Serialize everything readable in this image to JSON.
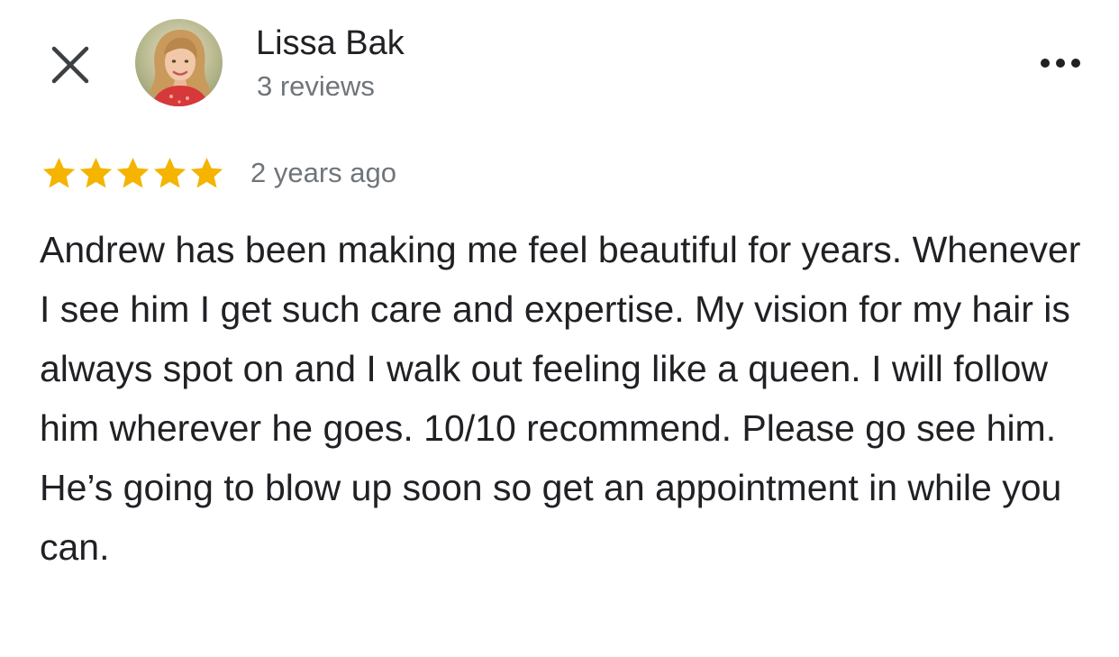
{
  "header": {
    "close_icon": "close-icon",
    "reviewer_name": "Lissa Bak",
    "review_count": "3 reviews",
    "more_icon": "more-horizontal-icon"
  },
  "review": {
    "rating": 5,
    "rating_max": 5,
    "star_color": "#F4B400",
    "time": "2 years ago",
    "text": "Andrew has been making me feel beautiful for years. Whenever I see him I get such care and expertise. My vision for my hair is always spot on and I walk out feeling like a queen. I will follow him wherever he goes. 10/10 recommend. Please go see him. He’s going to blow up soon so get an appointment in while you can."
  }
}
